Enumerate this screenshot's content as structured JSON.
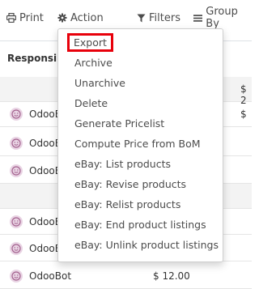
{
  "toolbar": {
    "print_label": "Print",
    "action_label": "Action",
    "filters_label": "Filters",
    "groupby_label": "Group By"
  },
  "table": {
    "header_label": "Responsib",
    "group_row_value": "$ 2",
    "rows": [
      {
        "name": "OdooE",
        "edge": "$"
      },
      {
        "name": "OdooE"
      },
      {
        "name": "OdooE"
      },
      {
        "name": "OdooE"
      },
      {
        "name": "OdooE"
      },
      {
        "name": "OdooBot",
        "price": "$ 12.00"
      }
    ]
  },
  "action_menu": {
    "items": [
      {
        "label": "Export",
        "highlighted": true
      },
      {
        "label": "Archive"
      },
      {
        "label": "Unarchive"
      },
      {
        "label": "Delete"
      },
      {
        "label": "Generate Pricelist"
      },
      {
        "label": "Compute Price from BoM"
      },
      {
        "label": "eBay: List products"
      },
      {
        "label": "eBay: Revise products"
      },
      {
        "label": "eBay: Relist products"
      },
      {
        "label": "eBay: End product listings"
      },
      {
        "label": "eBay: Unlink product listings"
      }
    ]
  },
  "colors": {
    "highlight_border": "#e8000b",
    "avatar_bg": "#e9d4e4",
    "avatar_fg": "#a4638f"
  },
  "icons": {
    "print": "printer-icon",
    "action": "gear-icon",
    "filters": "filter-icon",
    "groupby": "list-icon",
    "avatar": "smiley-avatar-icon"
  }
}
